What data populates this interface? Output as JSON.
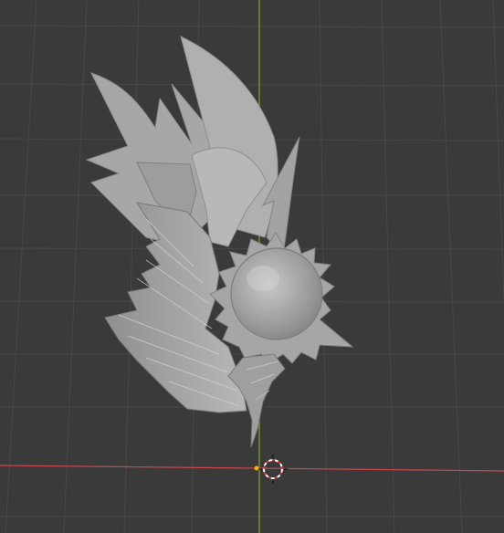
{
  "viewport": {
    "title": "",
    "background_color": "#3a3a3a",
    "grid_color": "#4a4a4a",
    "axis_x_color": "#c8474f",
    "axis_y_color": "#7ea33a",
    "model_color": "#a9a9a9",
    "model_shadow_color": "#7f7f7f",
    "model_highlight_color": "#d2d2d2",
    "cursor_icon": "3d-cursor-icon",
    "origin_icon": "object-origin-icon"
  }
}
